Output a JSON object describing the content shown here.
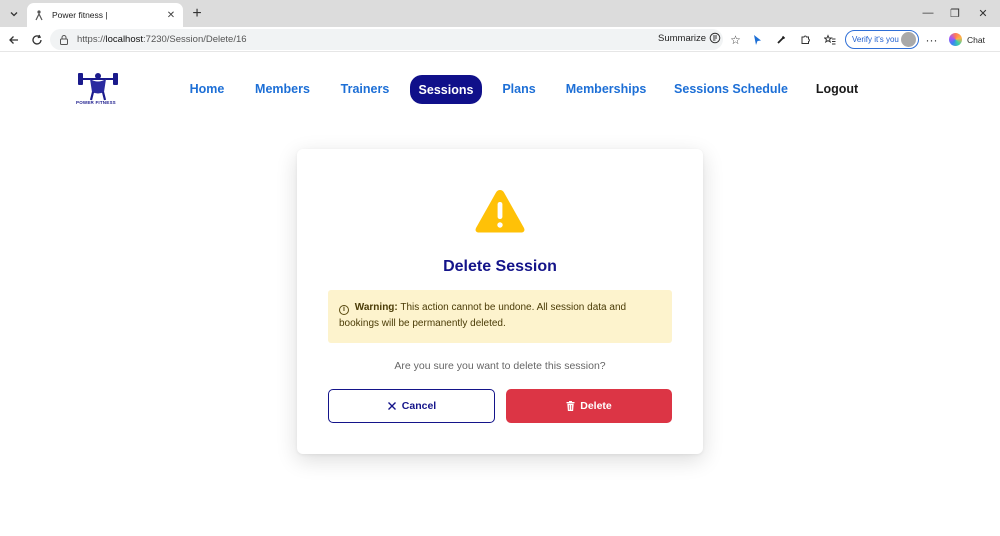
{
  "browser": {
    "tab_title": "Power fitness |",
    "url_scheme": "https://",
    "url_host": "localhost",
    "url_rest": ":7230/Session/Delete/16",
    "summarize_label": "Summarize",
    "verify_label": "Verify it's you",
    "chat_label": "Chat"
  },
  "brand": {
    "logo_text": "POWER FITNESS"
  },
  "nav": {
    "items": [
      {
        "label": "Home"
      },
      {
        "label": "Members"
      },
      {
        "label": "Trainers"
      },
      {
        "label": "Sessions",
        "active": true
      },
      {
        "label": "Plans"
      },
      {
        "label": "Memberships"
      },
      {
        "label": "Sessions Schedule"
      },
      {
        "label": "Logout"
      }
    ]
  },
  "modal": {
    "title": "Delete Session",
    "warning_label": "Warning:",
    "warning_text": "This action cannot be undone. All session data and bookings will be permanently deleted.",
    "question": "Are you sure you want to delete this session?",
    "cancel_label": "Cancel",
    "delete_label": "Delete"
  },
  "colors": {
    "brand_primary": "#14148a",
    "nav_link": "#1d6fd6",
    "danger": "#dc3545",
    "warning_bg": "#fdf3cd",
    "warning_icon": "#ffc107"
  }
}
